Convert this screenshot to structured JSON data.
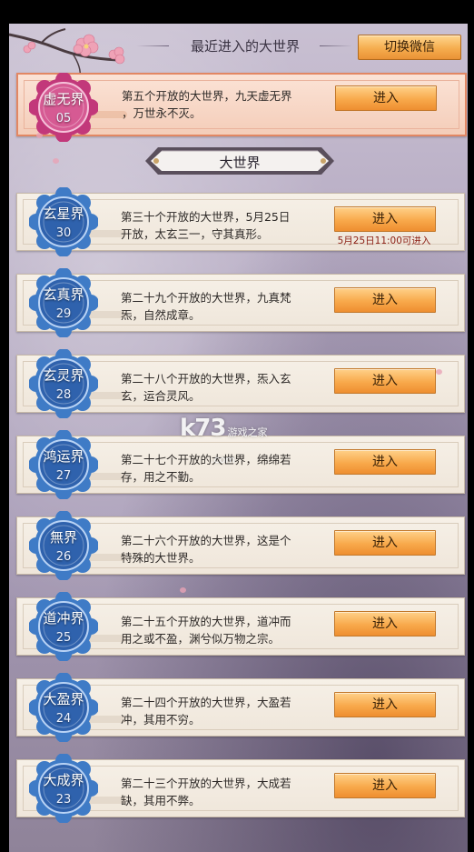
{
  "header": {
    "title": "最近进入的大世界",
    "switch_label": "切换微信"
  },
  "recent": {
    "name": "虚无界",
    "number": "05",
    "desc_line1": "第五个开放的大世界，九天虚无界",
    "desc_line2": "，万世永不灭。",
    "button": "进入",
    "badge_color": "#c2387a"
  },
  "section": {
    "title": "大世界"
  },
  "worlds": [
    {
      "name": "玄星界",
      "number": "30",
      "desc_line1": "第三十个开放的大世界，5月25日",
      "desc_line2": "开放，太玄三一，守其真形。",
      "button": "进入",
      "note": "5月25日11:00可进入"
    },
    {
      "name": "玄真界",
      "number": "29",
      "desc_line1": "第二十九个开放的大世界，九真梵",
      "desc_line2": "炁，自然成章。",
      "button": "进入"
    },
    {
      "name": "玄灵界",
      "number": "28",
      "desc_line1": "第二十八个开放的大世界，炁入玄",
      "desc_line2": "玄，运合灵风。",
      "button": "进入"
    },
    {
      "name": "鸿运界",
      "number": "27",
      "desc_line1": "第二十七个开放的大世界，绵绵若",
      "desc_line2": "存，用之不勤。",
      "button": "进入"
    },
    {
      "name": "無界",
      "number": "26",
      "desc_line1": "第二十六个开放的大世界，这是个",
      "desc_line2": "特殊的大世界。",
      "button": "进入"
    },
    {
      "name": "道冲界",
      "number": "25",
      "desc_line1": "第二十五个开放的大世界，道冲而",
      "desc_line2": "用之或不盈，渊兮似万物之宗。",
      "button": "进入"
    },
    {
      "name": "大盈界",
      "number": "24",
      "desc_line1": "第二十四个开放的大世界，大盈若",
      "desc_line2": "冲，其用不穷。",
      "button": "进入"
    },
    {
      "name": "大成界",
      "number": "23",
      "desc_line1": "第二十三个开放的大世界，大成若",
      "desc_line2": "缺，其用不弊。",
      "button": "进入"
    }
  ],
  "watermark": {
    "main": "k73",
    "sub": "游戏之家",
    "sub2": ".com"
  },
  "colors": {
    "world_badge": "#3f7bc6",
    "enter_button": "#f8a94b",
    "note_text": "#8a1c12"
  }
}
